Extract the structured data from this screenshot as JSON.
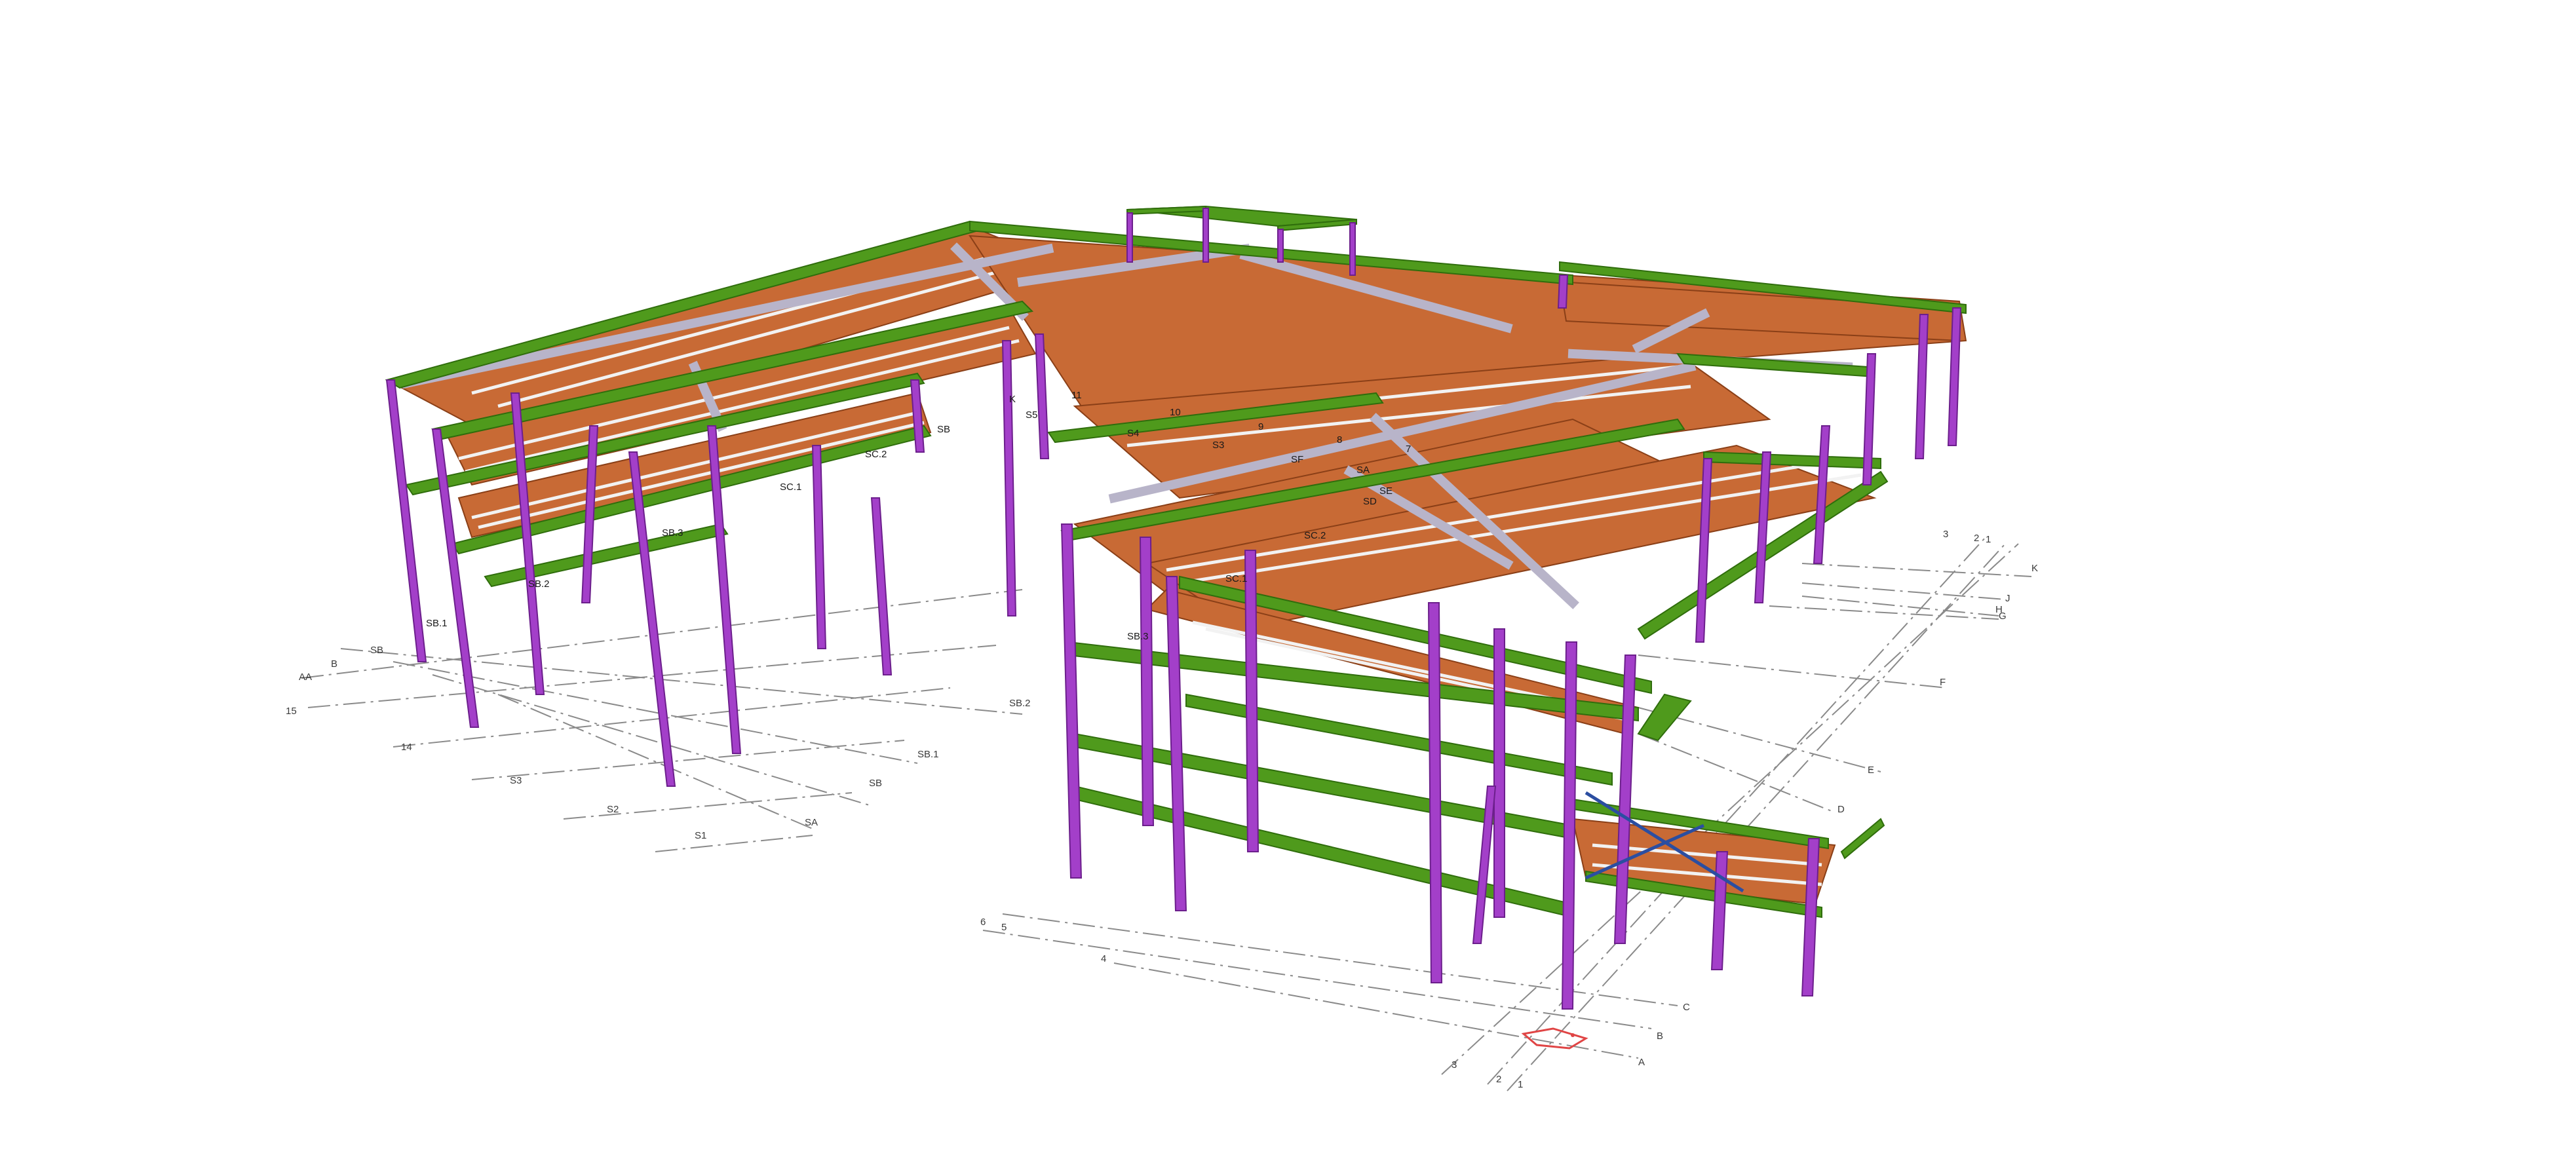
{
  "viewer": {
    "background": "#ffffff",
    "colors": {
      "steel_beam": "#4f9a1c",
      "column": "#a33fc9",
      "deck": "#c86a35",
      "roof_truss": "#b8b4c9",
      "grid_line": "#8a8a8a",
      "brace": "#2b4ea1",
      "origin_marker": "#e04545"
    }
  },
  "grid_labels": {
    "left_A": "AA",
    "left_B": "B",
    "left_SB": "SB",
    "left_15": "15",
    "left_14": "14",
    "left_S3": "S3",
    "left_S2": "S2",
    "left_S1": "S1",
    "row_SB2": "SB.2",
    "row_SB1": "SB.1",
    "row_SB": "SB",
    "row_SA": "SA",
    "col_6": "6",
    "col_5": "5",
    "col_4": "4",
    "col_3": "3",
    "col_2": "2",
    "col_1": "1",
    "right_C": "C",
    "right_B": "B",
    "right_A": "A",
    "right_D": "D",
    "right_E": "E",
    "right_F": "F",
    "right_G": "G",
    "right_H": "H",
    "right_J": "J",
    "right_K": "K",
    "right_top_3": "3",
    "right_top_2": "2",
    "right_top_1": "1"
  },
  "model_tags": {
    "SC2_left": "SC.2",
    "SC1_left": "SC.1",
    "SB3_left": "SB.3",
    "SB2_left": "SB.2",
    "SB1_left": "SB.1",
    "SC2_right": "SC.2",
    "SC1_right": "SC.1",
    "SB3_right": "SB.3",
    "n11": "11",
    "n10": "10",
    "n9": "9",
    "n8": "8",
    "n7": "7",
    "S5": "S5",
    "S4": "S4",
    "S3": "S3",
    "SF": "SF",
    "SE": "SE",
    "SD": "SD",
    "SA": "SA",
    "K": "K",
    "SB": "SB"
  }
}
